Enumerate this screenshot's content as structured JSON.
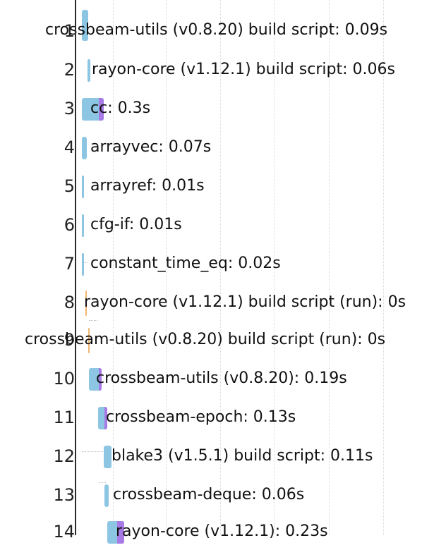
{
  "rows": [
    {
      "num": "1",
      "label": "crossbeam-utils (v0.8.20) build script: 0.09s"
    },
    {
      "num": "2",
      "label": "rayon-core (v1.12.1) build script: 0.06s"
    },
    {
      "num": "3",
      "label": "cc: 0.3s"
    },
    {
      "num": "4",
      "label": "arrayvec: 0.07s"
    },
    {
      "num": "5",
      "label": "arrayref: 0.01s"
    },
    {
      "num": "6",
      "label": "cfg-if: 0.01s"
    },
    {
      "num": "7",
      "label": "constant_time_eq: 0.02s"
    },
    {
      "num": "8",
      "label": "rayon-core (v1.12.1) build script (run): 0s"
    },
    {
      "num": "9",
      "label": "crossbeam-utils (v0.8.20) build script (run): 0s"
    },
    {
      "num": "10",
      "label": "crossbeam-utils (v0.8.20): 0.19s"
    },
    {
      "num": "11",
      "label": "crossbeam-epoch: 0.13s"
    },
    {
      "num": "12",
      "label": "blake3 (v1.5.1) build script: 0.11s"
    },
    {
      "num": "13",
      "label": "crossbeam-deque: 0.06s"
    },
    {
      "num": "14",
      "label": "rayon-core (v1.12.1): 0.23s"
    }
  ],
  "colors": {
    "build_bar": "#8cc6e3",
    "unlocked_bar": "#a77ae6",
    "run_bar": "#f0b772",
    "axis": "#2b2b2b"
  }
}
